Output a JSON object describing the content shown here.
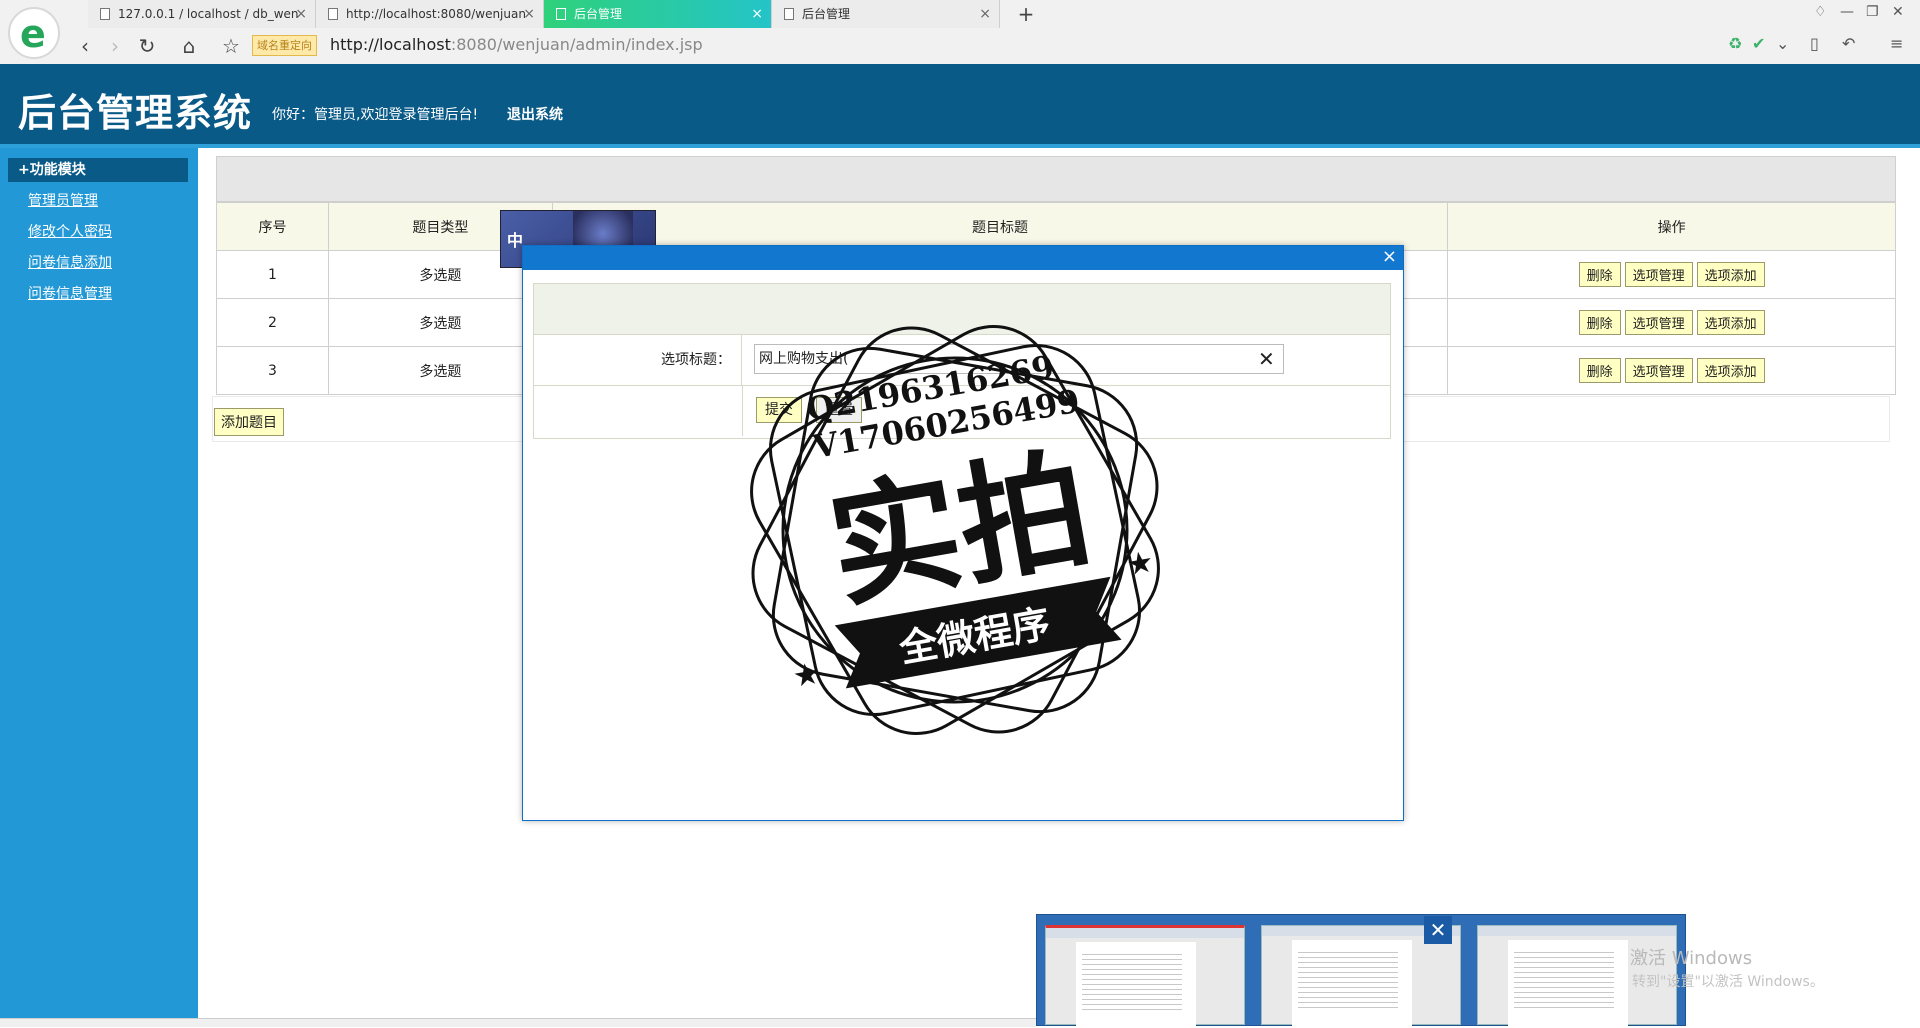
{
  "browser": {
    "tabs": [
      {
        "title": "127.0.0.1 / localhost / db_wen"
      },
      {
        "title": "http://localhost:8080/wenjuan"
      },
      {
        "title": "后台管理",
        "active": true
      },
      {
        "title": "后台管理"
      }
    ],
    "redirect_badge": "域名重定向",
    "url_host": "http://localhost",
    "url_rest": ":8080/wenjuan/admin/index.jsp",
    "accent": "#2fd17b"
  },
  "header": {
    "title": "后台管理系统",
    "welcome": "你好：管理员,欢迎登录管理后台!",
    "logout": "退出系统",
    "bg": "#0a5a88"
  },
  "sidebar": {
    "heading": "+功能模块",
    "items": [
      "管理员管理",
      "修改个人密码",
      "问卷信息添加",
      "问卷信息管理"
    ],
    "bg": "#2298d6"
  },
  "table": {
    "columns": [
      "序号",
      "题目类型",
      "题目标题",
      "操作"
    ],
    "rows": [
      {
        "no": "1",
        "type": "多选题"
      },
      {
        "no": "2",
        "type": "多选题"
      },
      {
        "no": "3",
        "type": "多选题"
      }
    ],
    "actions": [
      "删除",
      "选项管理",
      "选项添加"
    ],
    "add_button": "添加题目"
  },
  "ime": {
    "label": "中"
  },
  "dialog": {
    "close": "×",
    "field_label": "选项标题：",
    "field_value": "网上购物支出(",
    "clear": "✕",
    "submit": "提交",
    "reset": "重置"
  },
  "watermark": {
    "qq": "Q2196316269",
    "vx": "V17060256499",
    "big": "实拍",
    "banner": "全微程序"
  },
  "taskbar_preview": {
    "close": "✕"
  },
  "os_watermark": {
    "line1": "激活 Windows",
    "line2": "转到\"设置\"以激活 Windows。"
  }
}
